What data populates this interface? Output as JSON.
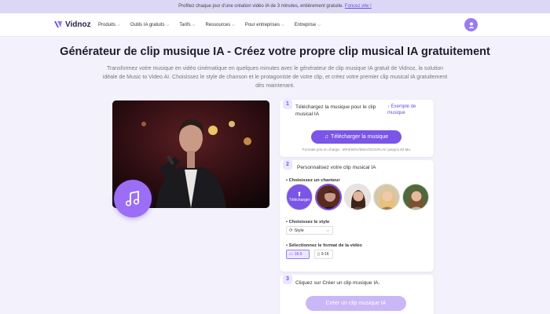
{
  "promo": {
    "text": "Profitez chaque jour d'une création vidéo IA de 3 minutes, entièrement gratuite.",
    "link": "Foncez vite !"
  },
  "nav": {
    "brand": "Vidnoz",
    "items": [
      {
        "label": "Produits"
      },
      {
        "label": "Outils IA gratuits"
      },
      {
        "label": "Tarifs"
      },
      {
        "label": "Ressources"
      },
      {
        "label": "Pour entreprises"
      },
      {
        "label": "Entreprise"
      }
    ]
  },
  "hero": {
    "title": "Générateur de clip musique IA - Créez votre propre clip musical IA gratuitement",
    "description": "Transformez votre musique en vidéo cinématique en quelques minutes avec le générateur de clip musique IA gratuit de Vidnoz, la solution idéale de Music to Video AI. Choisissez le style de chanson et le protagoniste de votre clip, et créez votre premier clip musical IA gratuitement dès maintenant."
  },
  "step1": {
    "number": "1",
    "label": "Téléchargez la musique pour le clip musical IA",
    "example_link": "↓ Exemple de musique",
    "upload_button": "Télécharger la musique",
    "formats": "Formats pris en charge : MP3/WAV/M4A/OGG/FLAC jusqu'à 50 Mo."
  },
  "step2": {
    "number": "2",
    "label": "Personnalisez votre clip musical IA",
    "singer_label": "• Choisissez un chanteur",
    "upload_singer": "Télécharger",
    "style_label": "• Choisissez le style",
    "style_value": "Style",
    "format_label": "• Sélectionnez le format de la vidéo",
    "format_169": "16:9",
    "format_916": "9:16"
  },
  "step3": {
    "number": "3",
    "label": "Cliquez sur Créer un clip musique IA.",
    "create_button": "Créer un clip musique IA"
  },
  "colors": {
    "accent": "#7a55e6",
    "promo_bg": "#dcd7f5",
    "page_bg": "#f3f1fb"
  }
}
